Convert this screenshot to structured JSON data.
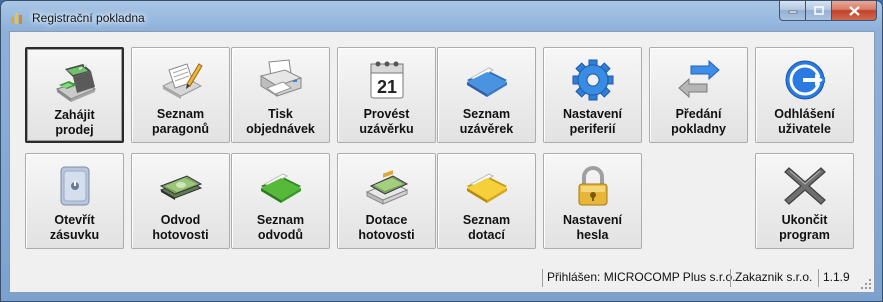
{
  "window": {
    "title": "Registrační pokladna"
  },
  "tiles_row1": [
    {
      "label": "Zahájit\nprodej",
      "icon": "cash-register-icon"
    },
    {
      "label": "Seznam\nparagonů",
      "icon": "receipt-list-icon"
    },
    {
      "label": "Tisk\nobjednávek",
      "icon": "printer-icon"
    },
    {
      "label": "Provést\nuzávěrku",
      "icon": "calendar-icon",
      "calendar_day": "21"
    },
    {
      "label": "Seznam\nuzávěrek",
      "icon": "blue-folder-icon"
    },
    {
      "label": "Nastavení\nperiferií",
      "icon": "gear-icon"
    },
    {
      "label": "Předání\npokladny",
      "icon": "exchange-arrows-icon"
    },
    {
      "label": "Odhlášení\nuživatele",
      "icon": "logout-icon"
    }
  ],
  "tiles_row2": [
    {
      "label": "Otevřít\nzásuvku",
      "icon": "safe-icon"
    },
    {
      "label": "Odvod\nhotovosti",
      "icon": "banknotes-icon"
    },
    {
      "label": "Seznam\nodvodů",
      "icon": "green-folder-icon"
    },
    {
      "label": "Dotace\nhotovosti",
      "icon": "money-stack-icon"
    },
    {
      "label": "Seznam\ndotací",
      "icon": "yellow-folder-icon"
    },
    {
      "label": "Nastavení\nhesla",
      "icon": "padlock-icon"
    },
    {
      "label": "Ukončit\nprogram",
      "icon": "close-x-icon"
    }
  ],
  "status": {
    "user": "Přihlášen: MICROCOMP Plus s.r.o.",
    "customer": "Zakaznik s.r.o.",
    "version": "1.1.9"
  },
  "colors": {
    "tile_bg": "#ececec",
    "folder_blue": "#3b86d6",
    "folder_green": "#4caf2f",
    "folder_yellow": "#f2c623",
    "close_red": "#c0432b"
  }
}
